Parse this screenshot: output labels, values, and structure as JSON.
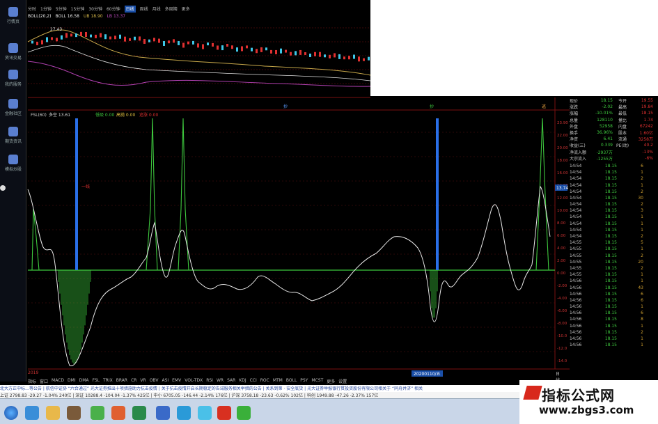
{
  "dock": {
    "items": [
      {
        "label": "行情页"
      },
      {
        "label": "资讯交易"
      },
      {
        "label": "我的服务"
      },
      {
        "label": "金融社区"
      },
      {
        "label": "期货资讯"
      },
      {
        "label": "模拟炒股"
      }
    ]
  },
  "period_tabs": [
    "分时",
    "1分钟",
    "5分钟",
    "15分钟",
    "30分钟",
    "60分钟",
    "日线",
    "周线",
    "月线",
    "多周期",
    "更多"
  ],
  "period_active": "日线",
  "boll": {
    "title": "BOLL(20,2)",
    "mid": "BOLL 16.58",
    "upper": "UB 18.90",
    "lower": "LB 13.37",
    "price_label": "27.43"
  },
  "indicator": {
    "name": "FSL(60)",
    "values": [
      "多空 13.61",
      "低吸 0.00",
      "高抛 0.00",
      "追涨 0.00"
    ],
    "overlay_note": "一线"
  },
  "signal_labels": [
    "抄",
    "抄",
    "逃"
  ],
  "price_tag": "13.74",
  "date_axis": {
    "start": "2019",
    "highlight": "20200110/五",
    "end": "日线"
  },
  "ind_tabs": [
    "指标",
    "窗口",
    "MACD",
    "DMI",
    "DMA",
    "FSL",
    "TRIX",
    "BRAR",
    "CR",
    "VR",
    "OBV",
    "ASI",
    "EMV",
    "VOL-TDX",
    "RSI",
    "WR",
    "SAR",
    "KDJ",
    "CCI",
    "ROC",
    "MTM",
    "BOLL",
    "PSY",
    "MCST",
    "更多",
    "设置"
  ],
  "quote": {
    "rows": [
      {
        "k": "现价",
        "v": "18.15",
        "k2": "今开",
        "v2": "19.55"
      },
      {
        "k": "涨跌",
        "v": "-2.02",
        "k2": "最高",
        "v2": "19.84"
      },
      {
        "k": "涨幅",
        "v": "-10.01%",
        "k2": "最低",
        "v2": "18.15"
      },
      {
        "k": "总量",
        "v": "128110",
        "k2": "量比",
        "v2": "1.74"
      },
      {
        "k": "外盘",
        "v": "52958",
        "k2": "内盘",
        "v2": "67242"
      },
      {
        "k": "换手",
        "v": "36.96%",
        "k2": "股本",
        "v2": "1.60亿"
      },
      {
        "k": "净资",
        "v": "6.41",
        "k2": "流通",
        "v2": "3258万"
      },
      {
        "k": "收益(三)",
        "v": "0.339",
        "k2": "PE(动)",
        "v2": "40.2"
      },
      {
        "k": "净流入额",
        "v": "-2937万",
        "k2": "",
        "v2": "-13%"
      },
      {
        "k": "大宗流入",
        "v": "-1255万",
        "k2": "",
        "v2": "-6%"
      }
    ],
    "ticks": [
      {
        "t": "14:54",
        "p": "18.15",
        "v": "6"
      },
      {
        "t": "14:54",
        "p": "18.15",
        "v": "1"
      },
      {
        "t": "14:54",
        "p": "18.15",
        "v": "2"
      },
      {
        "t": "14:54",
        "p": "18.15",
        "v": "1"
      },
      {
        "t": "14:54",
        "p": "18.15",
        "v": "2"
      },
      {
        "t": "14:54",
        "p": "18.15",
        "v": "30"
      },
      {
        "t": "14:54",
        "p": "18.15",
        "v": "2"
      },
      {
        "t": "14:54",
        "p": "18.15",
        "v": "3"
      },
      {
        "t": "14:54",
        "p": "18.15",
        "v": "1"
      },
      {
        "t": "14:54",
        "p": "18.15",
        "v": "1"
      },
      {
        "t": "14:54",
        "p": "18.15",
        "v": "1"
      },
      {
        "t": "14:54",
        "p": "18.15",
        "v": "2"
      },
      {
        "t": "14:55",
        "p": "18.15",
        "v": "5"
      },
      {
        "t": "14:55",
        "p": "18.15",
        "v": "1"
      },
      {
        "t": "14:55",
        "p": "18.15",
        "v": "2"
      },
      {
        "t": "14:55",
        "p": "18.15",
        "v": "20"
      },
      {
        "t": "14:55",
        "p": "18.15",
        "v": "2"
      },
      {
        "t": "14:55",
        "p": "18.15",
        "v": "1"
      },
      {
        "t": "14:56",
        "p": "18.15",
        "v": "1"
      },
      {
        "t": "14:56",
        "p": "18.15",
        "v": "43"
      },
      {
        "t": "14:56",
        "p": "18.15",
        "v": "6"
      },
      {
        "t": "14:56",
        "p": "18.15",
        "v": "6"
      },
      {
        "t": "14:56",
        "p": "18.15",
        "v": "1"
      },
      {
        "t": "14:56",
        "p": "18.15",
        "v": "6"
      },
      {
        "t": "14:56",
        "p": "18.15",
        "v": "8"
      },
      {
        "t": "14:56",
        "p": "18.15",
        "v": "1"
      },
      {
        "t": "14:56",
        "p": "18.15",
        "v": "2"
      },
      {
        "t": "14:56",
        "p": "18.15",
        "v": "1"
      },
      {
        "t": "14:56",
        "p": "18.15",
        "v": "1"
      }
    ]
  },
  "news": "北大方正中标…等公告 | 航信中证协 “六合通过” 光大证券推出十项措施助力抗击疫情 | 关于抗击疫情开启长期稳定的告诫服务相关举措的公告 | 关系到第 · 安全底货 | 光大证券举报银行贯投资股份有限公司相关于 “同舟并济” 相关",
  "indexes": "上证 2798.83 -29.27 -1.04% 240亿 | 深证 10288.4 -104.04 -1.37% 425亿 | 中小 6705.05 -146.44 -2.14% 176亿 | 沪深 3758.18 -23.63 -0.62% 102亿 | 科创 1949.88 -47.26 -2.37% 157亿",
  "watermark": {
    "cn": "指标公式网",
    "en": "www.zbgs3.com"
  }
}
